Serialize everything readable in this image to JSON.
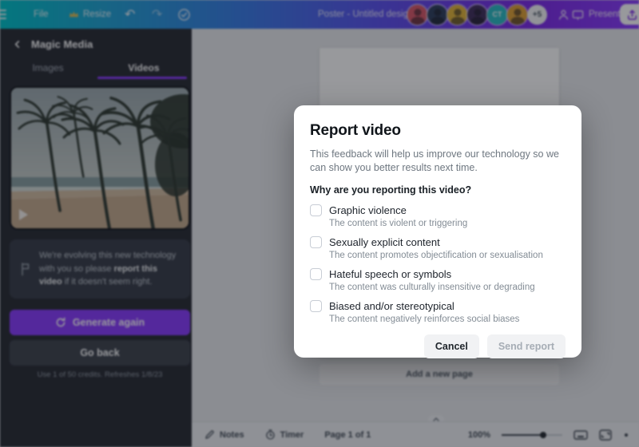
{
  "topbar": {
    "file": "File",
    "resize": "Resize",
    "doc_title": "Poster - Untitled design",
    "present": "Present",
    "avatar_initials": "CT",
    "avatar_overflow": "+5"
  },
  "sidebar": {
    "title": "Magic Media",
    "tabs": {
      "images": "Images",
      "videos": "Videos"
    },
    "notice": {
      "pre": "We're evolving this new technology with you so please ",
      "bold": "report this video",
      "post": " if it doesn't seem right."
    },
    "generate_button": "Generate again",
    "go_back_button": "Go back",
    "credits": "Use 1 of 50 credits. Refreshes 1/8/23"
  },
  "canvas": {
    "add_page_button": "Add a new page"
  },
  "modal": {
    "title": "Report video",
    "description": "This feedback will help us improve our technology so we can show you better results next time.",
    "question": "Why are you reporting this video?",
    "options": [
      {
        "label": "Graphic violence",
        "description": "The content is violent or triggering"
      },
      {
        "label": "Sexually explicit content",
        "description": "The content promotes objectification or sexualisation"
      },
      {
        "label": "Hateful speech or symbols",
        "description": "The content was culturally insensitive or degrading"
      },
      {
        "label": "Biased and/or stereotypical",
        "description": "The content negatively reinforces social biases"
      }
    ],
    "cancel_button": "Cancel",
    "send_button": "Send report"
  },
  "bottombar": {
    "notes": "Notes",
    "timer": "Timer",
    "page_indicator": "Page 1 of 1",
    "zoom_level": "100%"
  },
  "colors": {
    "accent_purple": "#8b3dff",
    "topbar_gradient_start": "#00c4cc",
    "topbar_gradient_end": "#8b3dff",
    "sidebar_bg": "#2a2d35"
  }
}
